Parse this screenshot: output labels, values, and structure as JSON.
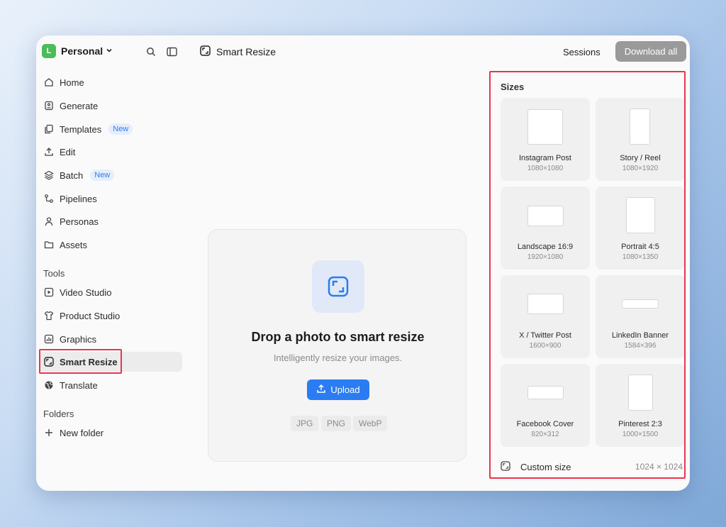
{
  "header": {
    "avatar_letter": "L",
    "workspace": "Personal",
    "page_title": "Smart Resize",
    "sessions_label": "Sessions",
    "download_label": "Download all"
  },
  "sidebar": {
    "items": [
      {
        "label": "Home",
        "icon": "home-icon"
      },
      {
        "label": "Generate",
        "icon": "image-icon"
      },
      {
        "label": "Templates",
        "icon": "copy-icon",
        "badge": "New"
      },
      {
        "label": "Edit",
        "icon": "upload-icon"
      },
      {
        "label": "Batch",
        "icon": "layers-icon",
        "badge": "New"
      },
      {
        "label": "Pipelines",
        "icon": "pipeline-icon"
      },
      {
        "label": "Personas",
        "icon": "person-icon"
      },
      {
        "label": "Assets",
        "icon": "folder-icon"
      }
    ],
    "tools_label": "Tools",
    "tools": [
      {
        "label": "Video Studio",
        "icon": "video-icon"
      },
      {
        "label": "Product Studio",
        "icon": "shirt-icon"
      },
      {
        "label": "Graphics",
        "icon": "chart-icon"
      },
      {
        "label": "Smart Resize",
        "icon": "resize-icon"
      },
      {
        "label": "Translate",
        "icon": "globe-icon"
      }
    ],
    "folders_label": "Folders",
    "new_folder_label": "New folder"
  },
  "dropzone": {
    "title": "Drop a photo to smart resize",
    "subtitle": "Intelligently resize your images.",
    "upload_label": "Upload",
    "formats": [
      "JPG",
      "PNG",
      "WebP"
    ]
  },
  "sizes": {
    "title": "Sizes",
    "items": [
      {
        "name": "Instagram Post",
        "dims": "1080×1080"
      },
      {
        "name": "Story / Reel",
        "dims": "1080×1920"
      },
      {
        "name": "Landscape 16:9",
        "dims": "1920×1080"
      },
      {
        "name": "Portrait 4:5",
        "dims": "1080×1350"
      },
      {
        "name": "X / Twitter Post",
        "dims": "1600×900"
      },
      {
        "name": "LinkedIn Banner",
        "dims": "1584×396"
      },
      {
        "name": "Facebook Cover",
        "dims": "820×312"
      },
      {
        "name": "Pinterest 2:3",
        "dims": "1000×1500"
      }
    ],
    "custom_label": "Custom size",
    "custom_dims": "1024 × 1024"
  },
  "colors": {
    "accent": "#2a7cf2",
    "highlight": "#e8364c",
    "avatar": "#4cbb5a"
  }
}
